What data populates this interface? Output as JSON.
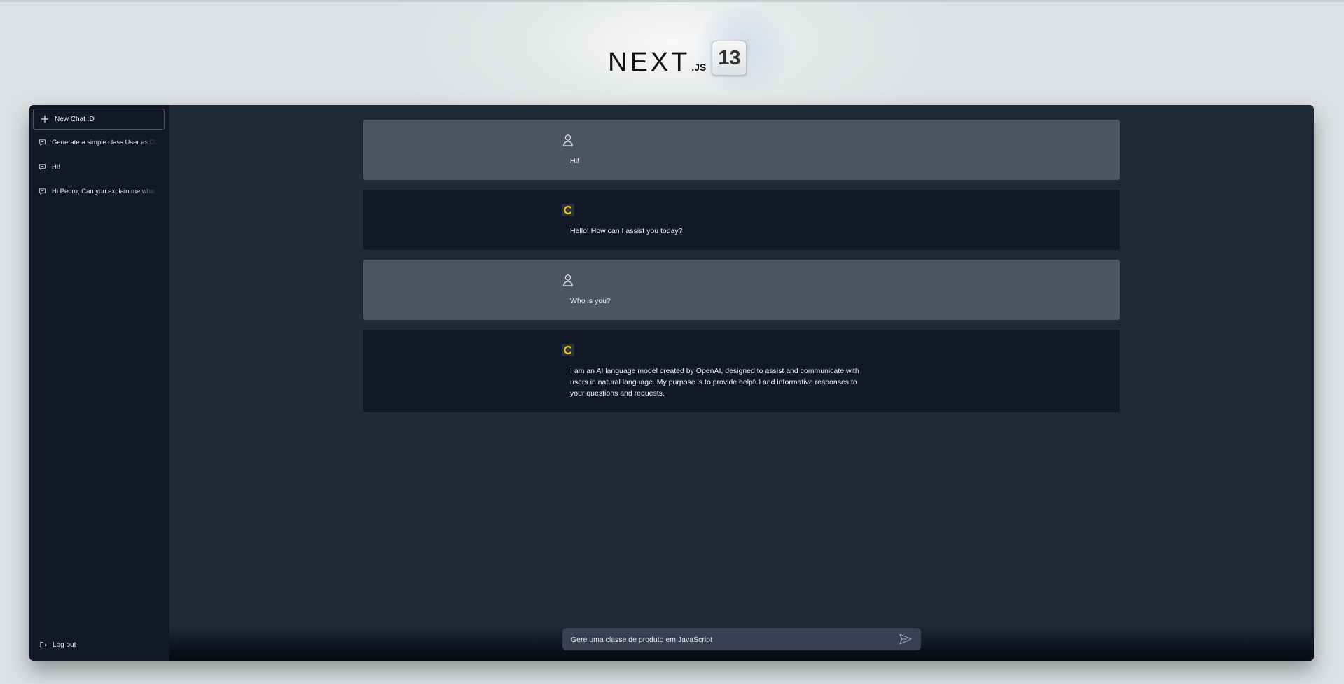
{
  "header": {
    "logo_word": "NEXT",
    "logo_suffix": ".JS",
    "version": "13"
  },
  "sidebar": {
    "new_chat_label": "New Chat :D",
    "chats": [
      {
        "label": "Generate a simple class User as DDD"
      },
      {
        "label": "Hi!"
      },
      {
        "label": "Hi Pedro, Can you explain me what is"
      }
    ],
    "logout_label": "Log out"
  },
  "messages": [
    {
      "role": "user",
      "text": "Hi!"
    },
    {
      "role": "assistant",
      "text": "Hello! How can I assist you today?"
    },
    {
      "role": "user",
      "text": "Who is you?"
    },
    {
      "role": "assistant",
      "text": "I am an AI language model created by OpenAI, designed to assist and communicate with users in natural language. My purpose is to provide helpful and informative responses to your questions and requests."
    }
  ],
  "composer": {
    "value": "Gere uma classe de produto em JavaScript"
  },
  "colors": {
    "sidebar_bg": "#111827",
    "main_bg": "#1f2937",
    "user_msg_bg": "#4b5563",
    "bot_msg_bg": "#111827",
    "bot_avatar_accent": "#f2c318"
  },
  "icons": {
    "new_chat": "plus-icon",
    "chat_item": "message-icon",
    "logout": "logout-icon",
    "user_avatar": "user-icon",
    "bot_avatar": "bot-logo-icon",
    "send": "send-icon"
  }
}
